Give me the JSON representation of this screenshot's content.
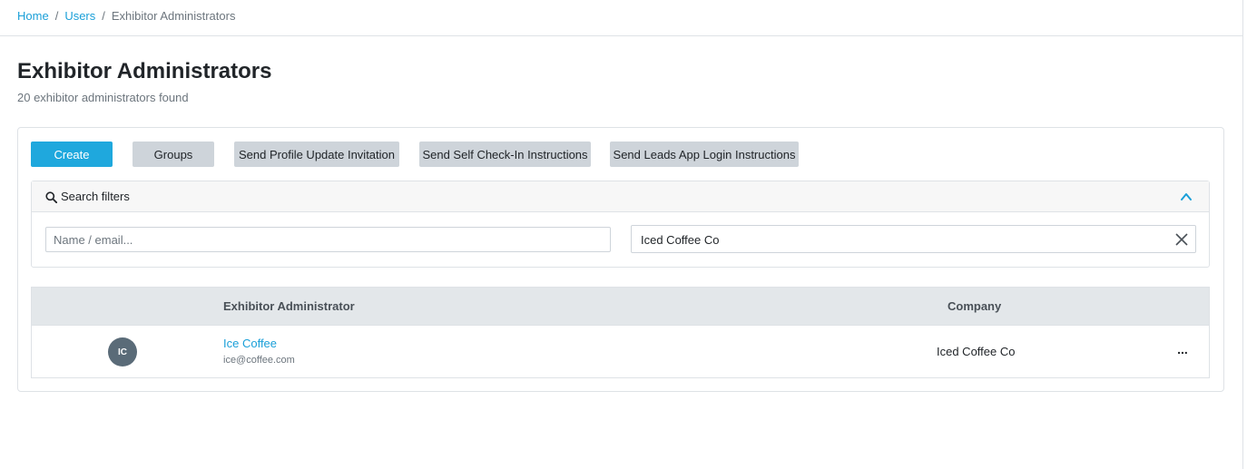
{
  "breadcrumb": {
    "home": "Home",
    "users": "Users",
    "separator": "/",
    "current": "Exhibitor Administrators"
  },
  "header": {
    "title": "Exhibitor Administrators",
    "subtitle": "20 exhibitor administrators found"
  },
  "toolbar": {
    "create": "Create",
    "groups": "Groups",
    "profile_update": "Send Profile Update Invitation",
    "self_checkin": "Send Self Check-In Instructions",
    "leads_app": "Send Leads App Login Instructions"
  },
  "filters": {
    "title": "Search filters",
    "name_placeholder": "Name / email...",
    "company_value": "Iced Coffee Co",
    "icons": {
      "search": "search-icon",
      "collapse": "chevron-up-icon",
      "clear": "close-icon"
    }
  },
  "table": {
    "columns": [
      "Exhibitor Administrator",
      "Company"
    ],
    "rows": [
      {
        "initials": "IC",
        "name": "Ice Coffee",
        "email": "ice@coffee.com",
        "company": "Iced Coffee Co",
        "actions": "..."
      }
    ]
  },
  "colors": {
    "primary": "#1fa8dd",
    "link": "#1a9fd8",
    "secondary_button": "#ced4da",
    "table_header": "#e3e7ea",
    "avatar": "#5a6b78"
  }
}
